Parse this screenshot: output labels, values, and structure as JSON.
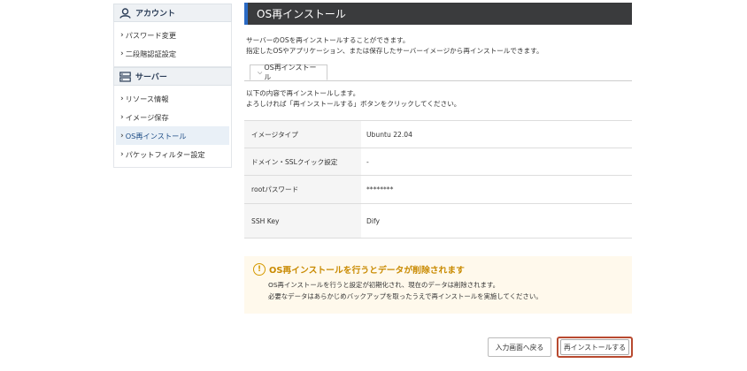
{
  "sidebar": {
    "account": {
      "label": "アカウント",
      "items": [
        {
          "label": "パスワード変更"
        },
        {
          "label": "二段階認証設定"
        }
      ]
    },
    "server": {
      "label": "サーバー",
      "items": [
        {
          "label": "リソース情報"
        },
        {
          "label": "イメージ保存"
        },
        {
          "label": "OS再インストール"
        },
        {
          "label": "パケットフィルター設定"
        }
      ]
    }
  },
  "page": {
    "title": "OS再インストール",
    "description_line1": "サーバーのOSを再インストールすることができます。",
    "description_line2": "指定したOSやアプリケーション、または保存したサーバーイメージから再インストールできます。",
    "tab_label": "OS再インストール",
    "confirm_line1": "以下の内容で再インストールします。",
    "confirm_line2": "よろしければ「再インストールする」ボタンをクリックしてください。"
  },
  "details": [
    {
      "key": "イメージタイプ",
      "value": "Ubuntu 22.04"
    },
    {
      "key": "ドメイン・SSLクイック設定",
      "value": "-"
    },
    {
      "key": "rootパスワード",
      "value": "********"
    },
    {
      "key": "SSH Key",
      "value": "Dify"
    }
  ],
  "warning": {
    "title": "OS再インストールを行うとデータが削除されます",
    "line1": "OS再インストールを行うと設定が初期化され、現在のデータは削除されます。",
    "line2": "必要なデータはあらかじめバックアップを取ったうえで再インストールを実施してください。"
  },
  "buttons": {
    "back": "入力画面へ戻る",
    "reinstall": "再インストールする"
  },
  "colors": {
    "title_bar": "#3a3b3d",
    "warning_text": "#c98a00",
    "reinstall_highlight": "#b84a30"
  }
}
